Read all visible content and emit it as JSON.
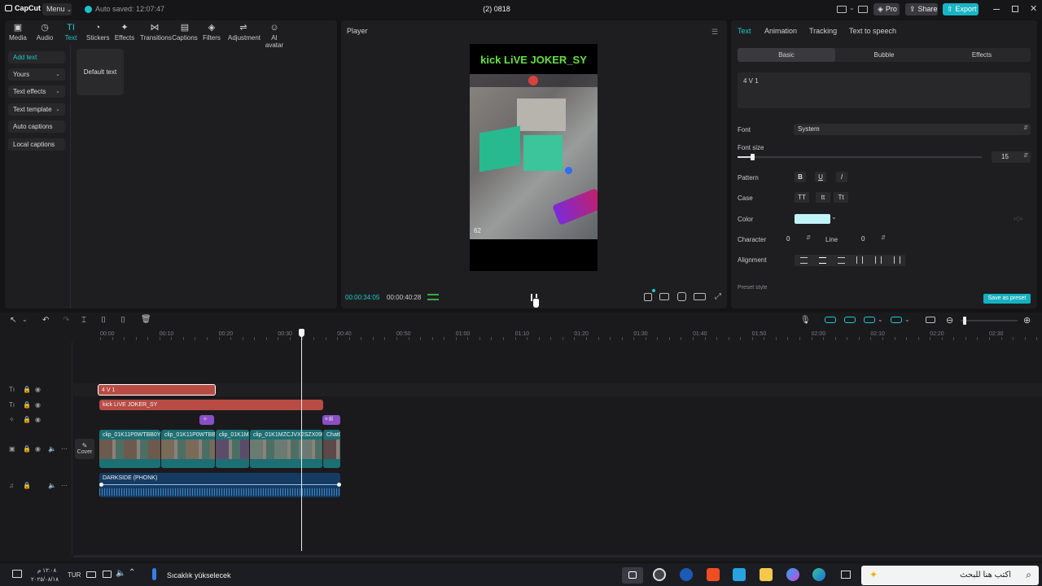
{
  "titlebar": {
    "logo": "CapCut",
    "menu": "Menu",
    "autosave": "Auto saved: 12:07:47",
    "project_title": "(2) 0818",
    "pro": "Pro",
    "share": "Share",
    "export": "Export"
  },
  "toolbar": [
    {
      "label": "Media",
      "icon": "media-icon",
      "glyph": "▣"
    },
    {
      "label": "Audio",
      "icon": "audio-icon",
      "glyph": "◷"
    },
    {
      "label": "Text",
      "icon": "text-icon",
      "glyph": "TI"
    },
    {
      "label": "Stickers",
      "icon": "stickers-icon",
      "glyph": "◔"
    },
    {
      "label": "Effects",
      "icon": "effects-icon",
      "glyph": "✦"
    },
    {
      "label": "Transitions",
      "icon": "transitions-icon",
      "glyph": "⋈"
    },
    {
      "label": "Captions",
      "icon": "captions-icon",
      "glyph": "▤"
    },
    {
      "label": "Filters",
      "icon": "filters-icon",
      "glyph": "◈"
    },
    {
      "label": "Adjustment",
      "icon": "adjustment-icon",
      "glyph": "⇌"
    },
    {
      "label": "AI avatar",
      "icon": "ai-avatar-icon",
      "glyph": "☺"
    }
  ],
  "sidebar": {
    "add_text": "Add text",
    "yours": "Yours",
    "text_effects": "Text effects",
    "text_template": "Text template",
    "auto_captions": "Auto captions",
    "local_captions": "Local captions",
    "default_text": "Default text"
  },
  "player": {
    "title": "Player",
    "video_overlay_text": "kick LiVE JOKER_SY",
    "ammo": "62",
    "current_time": "00:00:34:05",
    "total_time": "00:00:40:28"
  },
  "right": {
    "tabs": [
      "Text",
      "Animation",
      "Tracking",
      "Text to speech"
    ],
    "subtabs": [
      "Basic",
      "Bubble",
      "Effects"
    ],
    "text_value": "4 V 1",
    "font_label": "Font",
    "font_value": "System",
    "font_size_label": "Font size",
    "font_size_value": "15",
    "font_size_level": 0.02,
    "pattern_label": "Pattern",
    "pattern_buttons": [
      "B",
      "U",
      "I"
    ],
    "case_label": "Case",
    "case_buttons": [
      "TT",
      "tt",
      "Tt"
    ],
    "color_label": "Color",
    "color_value": "#bff3f7",
    "character_label": "Character",
    "character_value": "0",
    "line_label": "Line",
    "line_value": "0",
    "alignment_label": "Alignment",
    "preset_style": "Preset style",
    "save_preset": "Save as preset"
  },
  "timeline": {
    "ticks": [
      "00:00",
      "00:10",
      "00:20",
      "00:30",
      "00:40",
      "00:50",
      "01:00",
      "01:10",
      "01:20",
      "01:30",
      "01:40",
      "01:50",
      "02:00",
      "02:10",
      "02:20",
      "02:30"
    ],
    "text_clip_1": "4 V 1",
    "text_clip_2": "kick LiVE JOKER_SY",
    "effect_clip_2": "Ill",
    "video_clips": [
      "clip_01K11P0WTBB0Y82",
      "clip_01K11P0WTBB0Y",
      "clip_01K1MZ",
      "clip_01K1MZCJVX2SZX09RX1",
      "ChatG"
    ],
    "cover_label": "Cover",
    "audio_clip": "DARKSIDE  (PHONK)"
  },
  "taskbar": {
    "time": "١٢:٠٨ م",
    "date": "٢٠٢٥/٠٨/١٨",
    "lang": "TUR",
    "weather": "Sıcaklık yükselecek",
    "search_placeholder": "اكتب هنا للبحث"
  },
  "colors": {
    "accent": "#22c8cc",
    "text_clip": "#b84b43",
    "effect_clip": "#8a4fc4",
    "video_clip": "#1c6f73",
    "audio_clip": "#163b63"
  }
}
